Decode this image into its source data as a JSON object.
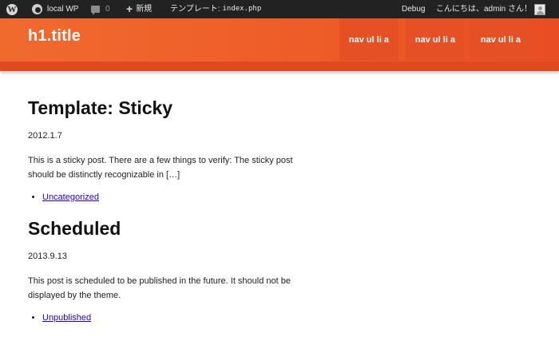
{
  "adminbar": {
    "site_name": "local WP",
    "comments_count": "0",
    "new_label": "新規",
    "template_label": "テンプレート:",
    "template_file": "index.php",
    "debug_label": "Debug",
    "greeting": "こんにちは、admin さん！"
  },
  "header": {
    "site_title": "h1.title",
    "nav": [
      "nav ul li a",
      "nav ul li a",
      "nav ul li a"
    ],
    "accent_color": "#ee5b28"
  },
  "posts": [
    {
      "title": "Template: Sticky",
      "date": "2012.1.7",
      "excerpt": "This is a sticky post. There are a few things to verify: The sticky post should be distinctly recognizable in […]",
      "category": "Uncategorized"
    },
    {
      "title": "Scheduled",
      "date": "2013.9.13",
      "excerpt": "This post is scheduled to be published in the future. It should not be displayed by the theme.",
      "category": "Unpublished"
    }
  ]
}
